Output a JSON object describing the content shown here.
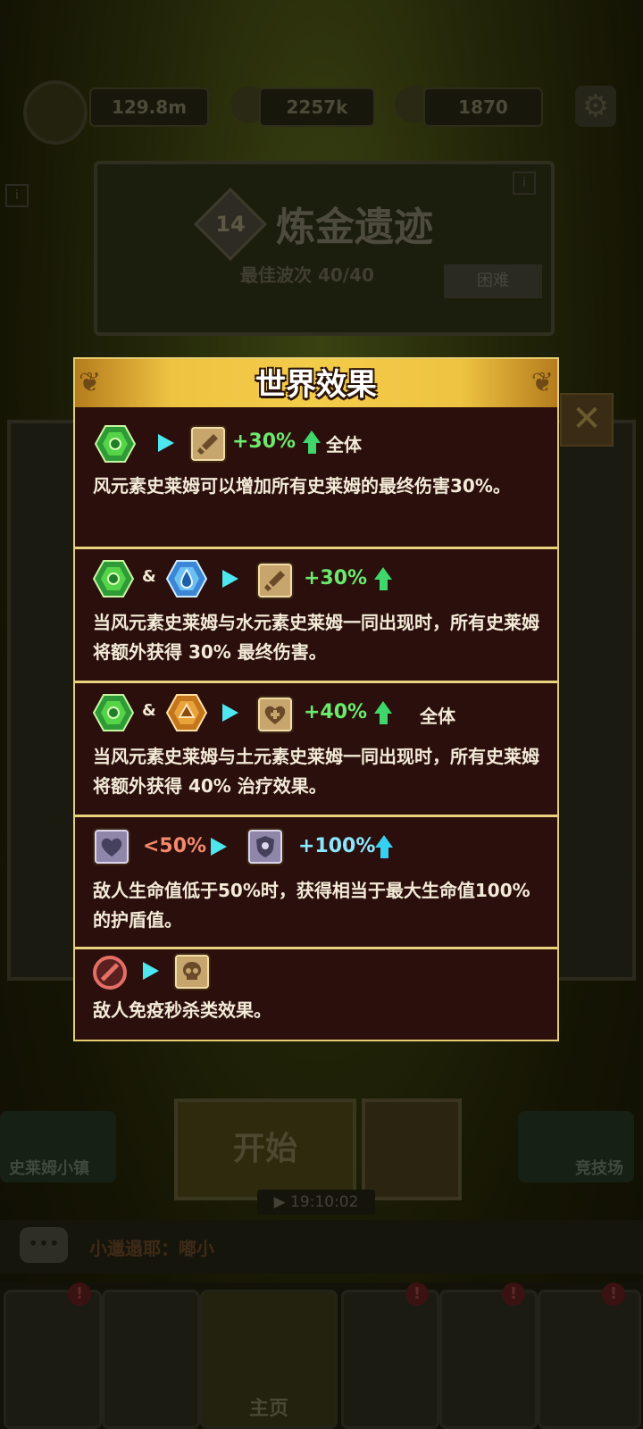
{
  "hud": {
    "power": "129.8m",
    "gold": "2257k",
    "gems": "1870"
  },
  "stage": {
    "number": "14",
    "title": "炼金遗迹",
    "best_wave_label": "最佳波次",
    "best_wave_value": "40/40",
    "difficulty": "困难"
  },
  "bottom": {
    "start_label": "开始",
    "town_label": "史莱姆小镇",
    "arena_label": "竞技场",
    "timer": "▶ 19:10:02",
    "chat_text": "小邋遢耶：嘟小",
    "nav_home": "主页"
  },
  "modal": {
    "title": "世界效果",
    "effects": [
      {
        "value": "+30%",
        "scope": "全体",
        "description": "风元素史莱姆可以增加所有史莱姆的最终伤害30%。"
      },
      {
        "amp": "&",
        "value": "+30%",
        "description": "当风元素史莱姆与水元素史莱姆一同出现时，所有史莱姆将额外获得 30% 最终伤害。"
      },
      {
        "amp": "&",
        "value": "+40%",
        "scope": "全体",
        "description": "当风元素史莱姆与土元素史莱姆一同出现时，所有史莱姆将额外获得 40% 治疗效果。"
      },
      {
        "condition": "<50%",
        "value": "+100%",
        "description": "敌人生命值低于50%时，获得相当于最大生命值100%的护盾值。"
      },
      {
        "description": "敌人免疫秒杀类效果。"
      }
    ]
  },
  "icons": {
    "wind_gem": "wind-element-icon",
    "water_gem": "water-element-icon",
    "earth_gem": "earth-element-icon",
    "sword": "sword-icon",
    "heal": "heart-heal-icon",
    "heart": "heart-icon",
    "shield": "shield-icon",
    "skull": "skull-icon",
    "no_entry": "no-entry-icon"
  },
  "colors": {
    "modal_bg": "#2b0f0d",
    "modal_border": "#e6cd72",
    "header_gold": "#f3cc4a",
    "value_green": "#6bea6d",
    "value_cyan": "#8be7ff",
    "value_red": "#f38a6c",
    "arrow_cyan": "#4ee7ef"
  }
}
